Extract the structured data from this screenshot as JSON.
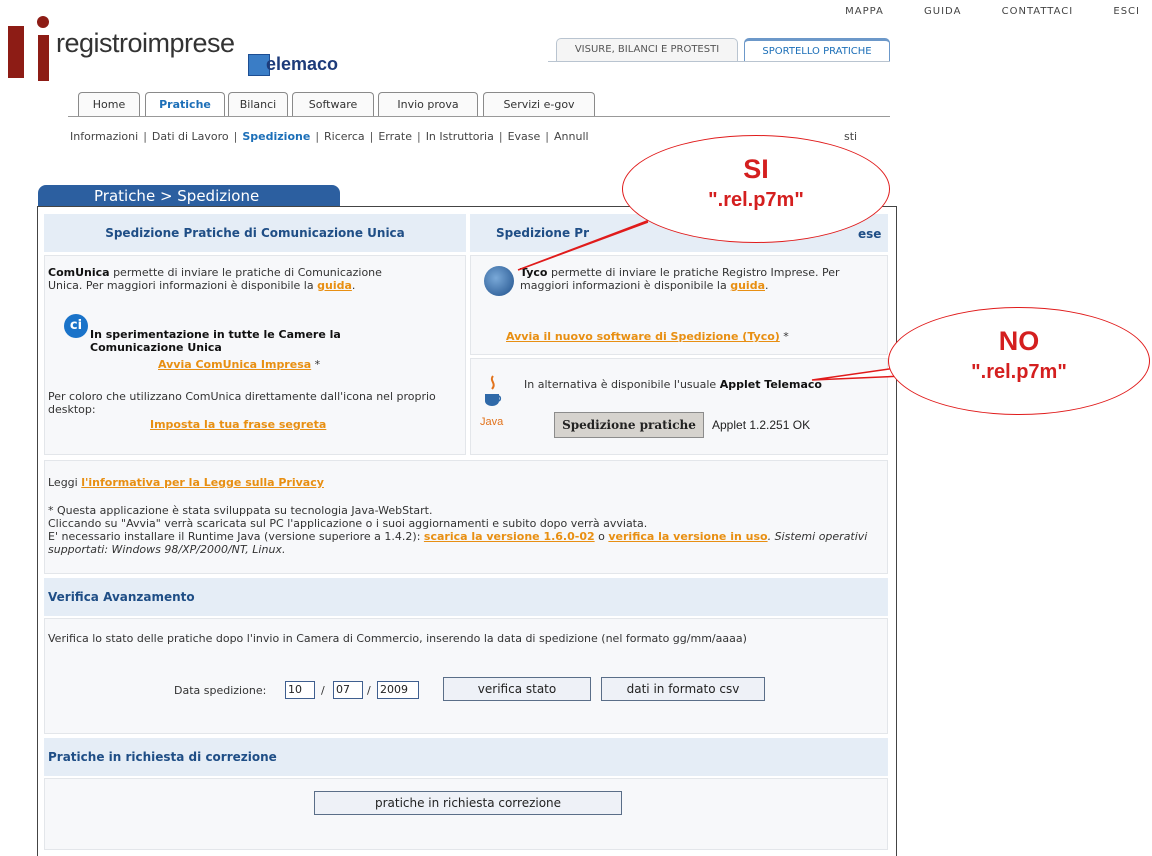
{
  "top_links": [
    "MAPPA",
    "GUIDA",
    "CONTATTACI",
    "ESCI"
  ],
  "logo": {
    "text": "registroimprese",
    "telemaco": "elemaco"
  },
  "top_tabs": [
    {
      "label": "VISURE, BILANCI E PROTESTI",
      "active": false
    },
    {
      "label": "SPORTELLO PRATICHE",
      "active": true
    }
  ],
  "main_tabs": [
    {
      "label": "Home",
      "active": false
    },
    {
      "label": "Pratiche",
      "active": true
    },
    {
      "label": "Bilanci",
      "active": false
    },
    {
      "label": "Software",
      "active": false
    },
    {
      "label": "Invio prova",
      "active": false
    },
    {
      "label": "Servizi e-gov",
      "active": false
    }
  ],
  "sub_nav": {
    "items": [
      "Informazioni",
      "Dati di Lavoro",
      "Spedizione",
      "Ricerca",
      "Errate",
      "In Istruttoria",
      "Evase",
      "Annull",
      "sti"
    ],
    "current": "Spedizione"
  },
  "section_title": "Pratiche > Spedizione",
  "left_panel": {
    "header": "Spedizione Pratiche di Comunicazione Unica",
    "comunica_bold": "ComUnica",
    "comunica_text": " permette di inviare le pratiche di Comunicazione Unica. Per maggiori informazioni è disponibile la ",
    "guida_link": "guida",
    "period": ".",
    "ci_icon": "ci",
    "sperim_text": "In sperimentazione in tutte le Camere la Comunicazione Unica",
    "avvia_link": "Avvia ComUnica Impresa",
    "asterisk": " *",
    "desktop_text": "Per coloro che utilizzano ComUnica direttamente dall'icona nel proprio desktop:",
    "frase_link": "Imposta la tua frase segreta"
  },
  "right_panel": {
    "header_start": "Spedizione Pr",
    "header_end": "ese",
    "tyco_bold": "Tyco",
    "tyco_text": " permette di inviare le pratiche Registro Imprese. Per maggiori informazioni è disponibile la ",
    "guida_link": "guida",
    "avvia_tyco_link": "Avvia il nuovo software di Spedizione (Tyco)",
    "asterisk": " *",
    "applet_text": "In alternativa è disponibile l'usuale ",
    "applet_bold": "Applet Telemaco",
    "java_label": "Java",
    "spedizione_button": "Spedizione pratiche",
    "applet_status": "Applet 1.2.251 OK"
  },
  "privacy": {
    "prefix": "Leggi ",
    "link": "l'informativa per la Legge sulla Privacy",
    "note1": "* Questa applicazione è stata sviluppata su tecnologia Java-WebStart.",
    "note2": "Cliccando su \"Avvia\" verrà scaricata sul PC l'applicazione o i suoi aggiornamenti e subito dopo verrà avviata.",
    "note3": "E' necessario installare il Runtime Java (versione superiore a 1.4.2): ",
    "scarica_link": "scarica la versione 1.6.0-02",
    "o": " o ",
    "verifica_link": "verifica la versione in uso",
    "sistemi": ". Sistemi operativi supportati: Windows 98/XP/2000/NT, Linux."
  },
  "verifica": {
    "header": "Verifica Avanzamento",
    "text": "Verifica lo stato delle pratiche dopo l'invio in Camera di Commercio, inserendo la data di spedizione (nel formato gg/mm/aaaa)",
    "date_label": "Data spedizione:",
    "day": "10",
    "month": "07",
    "year": "2009",
    "slash": "/",
    "verifica_button": "verifica stato",
    "csv_button": "dati in formato csv"
  },
  "correzione": {
    "header": "Pratiche in richiesta di correzione",
    "button": "pratiche in richiesta correzione"
  },
  "callouts": {
    "si_title": "SI",
    "si_sub": "\".rel.p7m\"",
    "no_title": "NO",
    "no_sub": "\".rel.p7m\""
  },
  "colors": {
    "accent_link": "#e88f12",
    "header_blue": "#1f4e86",
    "callout_red": "#d41f1f",
    "tab_blue": "#2c5fa0"
  }
}
